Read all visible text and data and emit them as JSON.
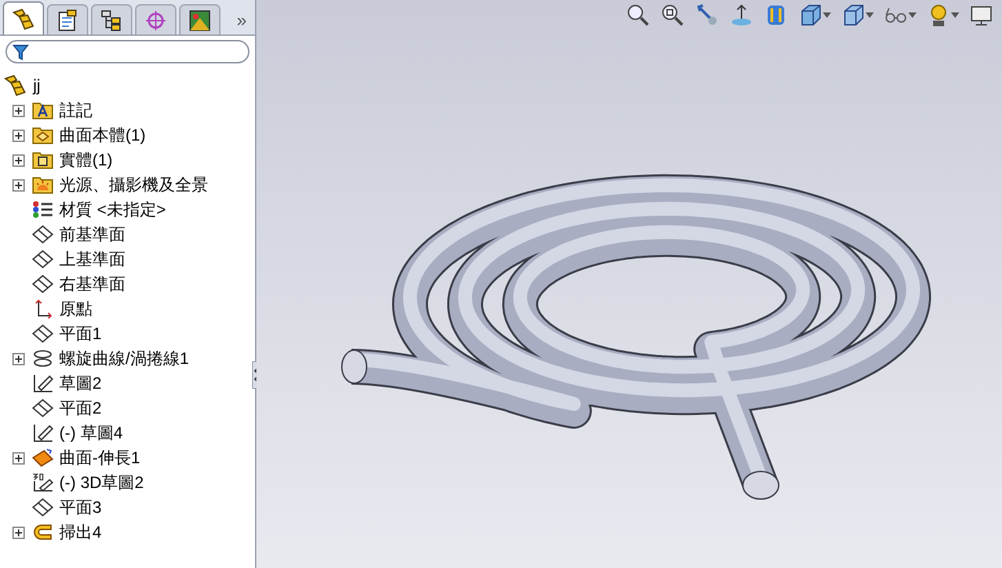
{
  "panel_tabs": [
    {
      "kind": "feature",
      "selected": true
    },
    {
      "kind": "property",
      "selected": false
    },
    {
      "kind": "config",
      "selected": false
    },
    {
      "kind": "dimxpert",
      "selected": false
    },
    {
      "kind": "display",
      "selected": false
    }
  ],
  "more_tabs": "»",
  "tree": {
    "root": "jj",
    "items": [
      {
        "label": "註記",
        "kind": "annotations",
        "expandable": true
      },
      {
        "label": "曲面本體(1)",
        "kind": "surface-bodies",
        "expandable": true
      },
      {
        "label": "實體(1)",
        "kind": "solid-bodies",
        "expandable": true
      },
      {
        "label": "光源、攝影機及全景",
        "kind": "lights",
        "expandable": true
      },
      {
        "label": "材質 <未指定>",
        "kind": "material",
        "expandable": false
      },
      {
        "label": "前基準面",
        "kind": "plane",
        "expandable": false
      },
      {
        "label": "上基準面",
        "kind": "plane",
        "expandable": false
      },
      {
        "label": "右基準面",
        "kind": "plane",
        "expandable": false
      },
      {
        "label": "原點",
        "kind": "origin",
        "expandable": false
      },
      {
        "label": "平面1",
        "kind": "plane",
        "expandable": false
      },
      {
        "label": "螺旋曲線/渦捲線1",
        "kind": "helix",
        "expandable": true
      },
      {
        "label": "草圖2",
        "kind": "sketch",
        "expandable": false
      },
      {
        "label": "平面2",
        "kind": "plane",
        "expandable": false
      },
      {
        "label": "(-) 草圖4",
        "kind": "sketch",
        "expandable": false
      },
      {
        "label": "曲面-伸長1",
        "kind": "extrude",
        "expandable": true
      },
      {
        "label": "(-) 3D草圖2",
        "kind": "sketch3d",
        "expandable": false
      },
      {
        "label": "平面3",
        "kind": "plane",
        "expandable": false
      },
      {
        "label": "掃出4",
        "kind": "sweep",
        "expandable": true
      }
    ]
  }
}
